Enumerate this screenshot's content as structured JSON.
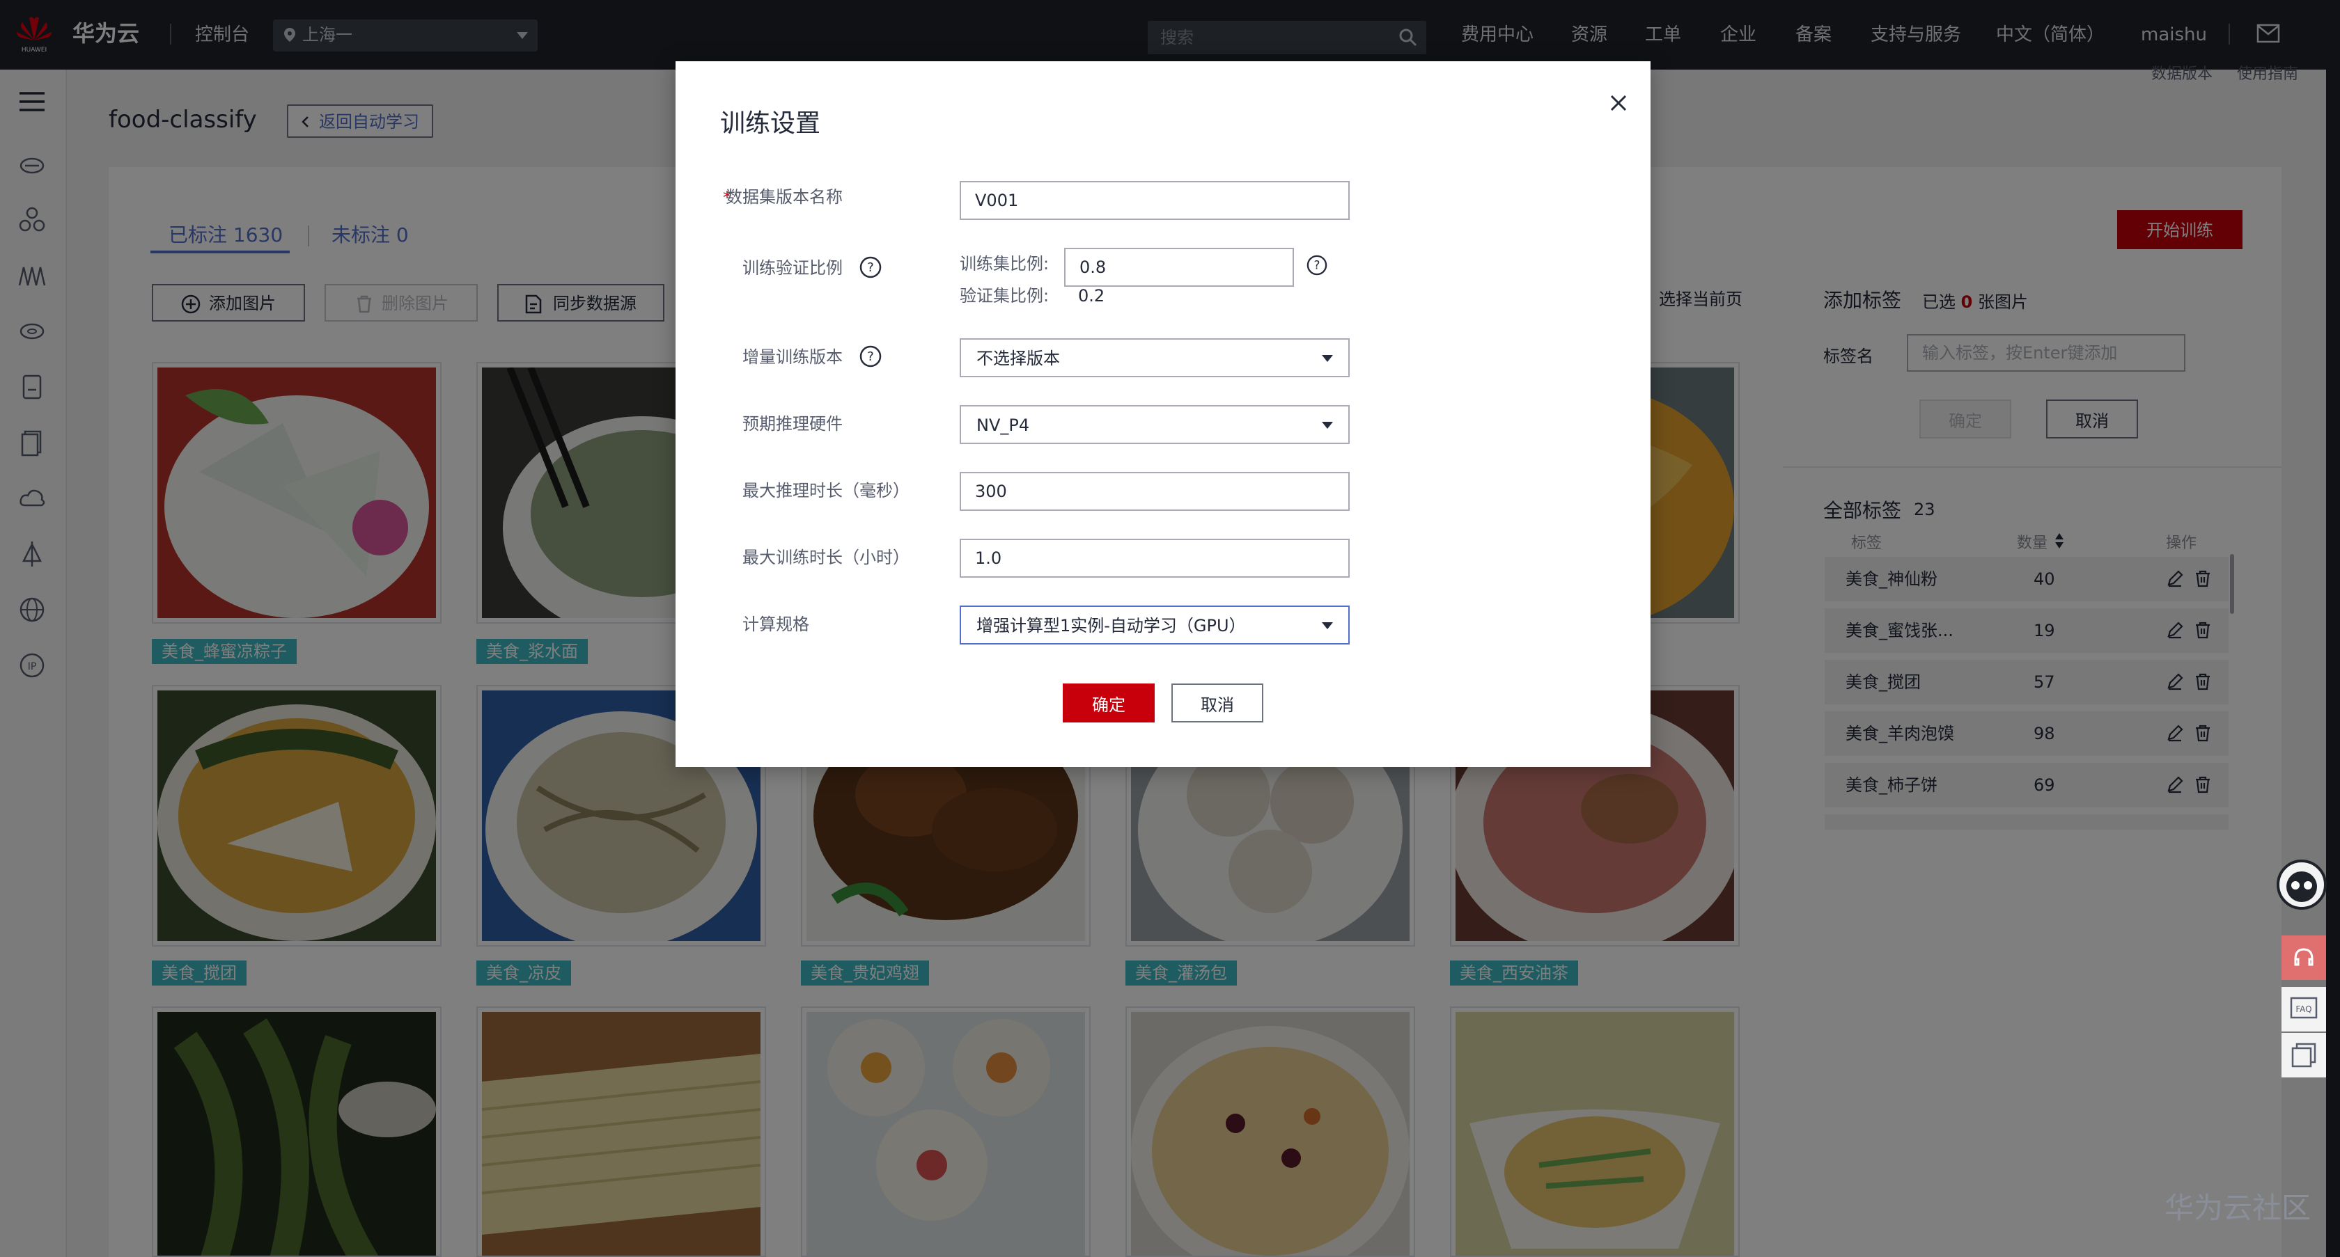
{
  "header": {
    "brand": "华为云",
    "logo_text": "HUAWEI",
    "console": "控制台",
    "region": "上海一",
    "search_placeholder": "搜索",
    "nav": [
      "费用中心",
      "资源",
      "工单",
      "企业",
      "备案",
      "支持与服务",
      "中文（简体）",
      "maishu"
    ]
  },
  "page": {
    "title": "food-classify",
    "back_label": "返回自动学习",
    "top_links": [
      "数据版本",
      "使用指南"
    ],
    "tabs": [
      {
        "label": "已标注 1630"
      },
      {
        "label": "未标注 0"
      }
    ],
    "toolbar": {
      "add_images": "添加图片",
      "delete_images": "删除图片",
      "sync_source": "同步数据源",
      "select_page": "选择当前页"
    },
    "start_training": "开始训练"
  },
  "label_panel": {
    "add_label_title": "添加标签",
    "selected_prefix": "已选",
    "selected_count": "0",
    "selected_suffix": "张图片",
    "label_name": "标签名",
    "input_placeholder": "输入标签，按Enter键添加",
    "ok": "确定",
    "cancel": "取消",
    "all_labels_title": "全部标签",
    "all_labels_count": "23",
    "columns": [
      "标签",
      "数量",
      "操作"
    ],
    "rows": [
      {
        "name": "美食_神仙粉",
        "count": "40"
      },
      {
        "name": "美食_蜜饯张...",
        "count": "19"
      },
      {
        "name": "美食_搅团",
        "count": "57"
      },
      {
        "name": "美食_羊肉泡馍",
        "count": "98"
      },
      {
        "name": "美食_柿子饼",
        "count": "69"
      }
    ]
  },
  "grid": {
    "tags": [
      "美食_蜂蜜凉粽子",
      "美食_浆水面",
      "美食_搅团",
      "美食_凉皮",
      "美食_贵妃鸡翅",
      "美食_灌汤包",
      "美食_西安油茶"
    ],
    "colors": {
      "tag": "#3fb8c4"
    }
  },
  "modal": {
    "title": "训练设置",
    "fields": {
      "dataset_version_label": "数据集版本名称",
      "dataset_version_value": "V001",
      "ratio_label": "训练验证比例",
      "train_ratio_label": "训练集比例:",
      "train_ratio_value": "0.8",
      "val_ratio_label": "验证集比例:",
      "val_ratio_value": "0.2",
      "incremental_label": "增量训练版本",
      "incremental_value": "不选择版本",
      "hardware_label": "预期推理硬件",
      "hardware_value": "NV_P4",
      "max_infer_label": "最大推理时长（毫秒）",
      "max_infer_value": "300",
      "max_train_label": "最大训练时长（小时）",
      "max_train_value": "1.0",
      "compute_label": "计算规格",
      "compute_value": "增强计算型1实例-自动学习（GPU）"
    },
    "ok": "确定",
    "cancel": "取消"
  },
  "watermark": "华为云社区",
  "colors": {
    "accent": "#c7000b",
    "link": "#526ecc",
    "header": "#1f2329"
  }
}
